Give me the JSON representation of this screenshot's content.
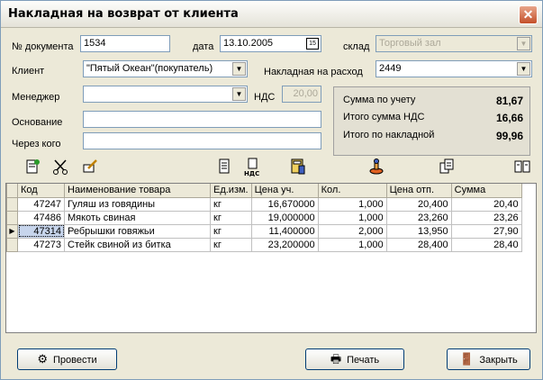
{
  "window": {
    "title": "Накладная на возврат от клиента",
    "close_glyph": "✕"
  },
  "form": {
    "doc_number_label": "№ документа",
    "doc_number": "1534",
    "date_label": "дата",
    "date": "13.10.2005",
    "calendar_glyph": "15",
    "warehouse_label": "склад",
    "warehouse": "Торговый зал",
    "client_label": "Клиент",
    "client": "\"Пятый Океан\"(покупатель)",
    "expense_invoice_label": "Накладная  на расход",
    "expense_invoice": "2449",
    "manager_label": "Менеджер",
    "manager": "",
    "vat_label": "НДС",
    "vat": "20,00",
    "basis_label": "Основание",
    "basis": "",
    "through_label": "Через кого",
    "through": ""
  },
  "summary": {
    "total_label": "Сумма по учету",
    "total": "81,67",
    "vat_total_label": "Итого сумма НДС",
    "vat_total": "16,66",
    "invoice_total_label": "Итого по накладной",
    "invoice_total": "99,96"
  },
  "table": {
    "columns": [
      "Код",
      "Наименование товара",
      "Ед.изм.",
      "Цена уч.",
      "Кол.",
      "Цена отп.",
      "Сумма"
    ],
    "rows": [
      [
        "47247",
        "Гуляш из говядины",
        "кг",
        "16,670000",
        "1,000",
        "20,400",
        "20,40"
      ],
      [
        "47486",
        "Мякоть свиная",
        "кг",
        "19,000000",
        "1,000",
        "23,260",
        "23,26"
      ],
      [
        "47314",
        "Ребрышки говяжьи",
        "кг",
        "11,400000",
        "2,000",
        "13,950",
        "27,90"
      ],
      [
        "47273",
        "Стейк свиной из битка",
        "кг",
        "23,200000",
        "1,000",
        "28,400",
        "28,40"
      ]
    ],
    "selected_row": 2
  },
  "buttons": {
    "post": "Провести",
    "print": "Печать",
    "close": "Закрыть"
  },
  "icons": {
    "add": "add-document-icon",
    "cut": "scissors-icon",
    "edit": "edit-icon",
    "doc": "document-icon",
    "vat": "vat-document-icon",
    "calc": "calculator-icon",
    "stamp": "stamp-icon",
    "copy": "copy-document-icon",
    "book": "book-icon"
  }
}
